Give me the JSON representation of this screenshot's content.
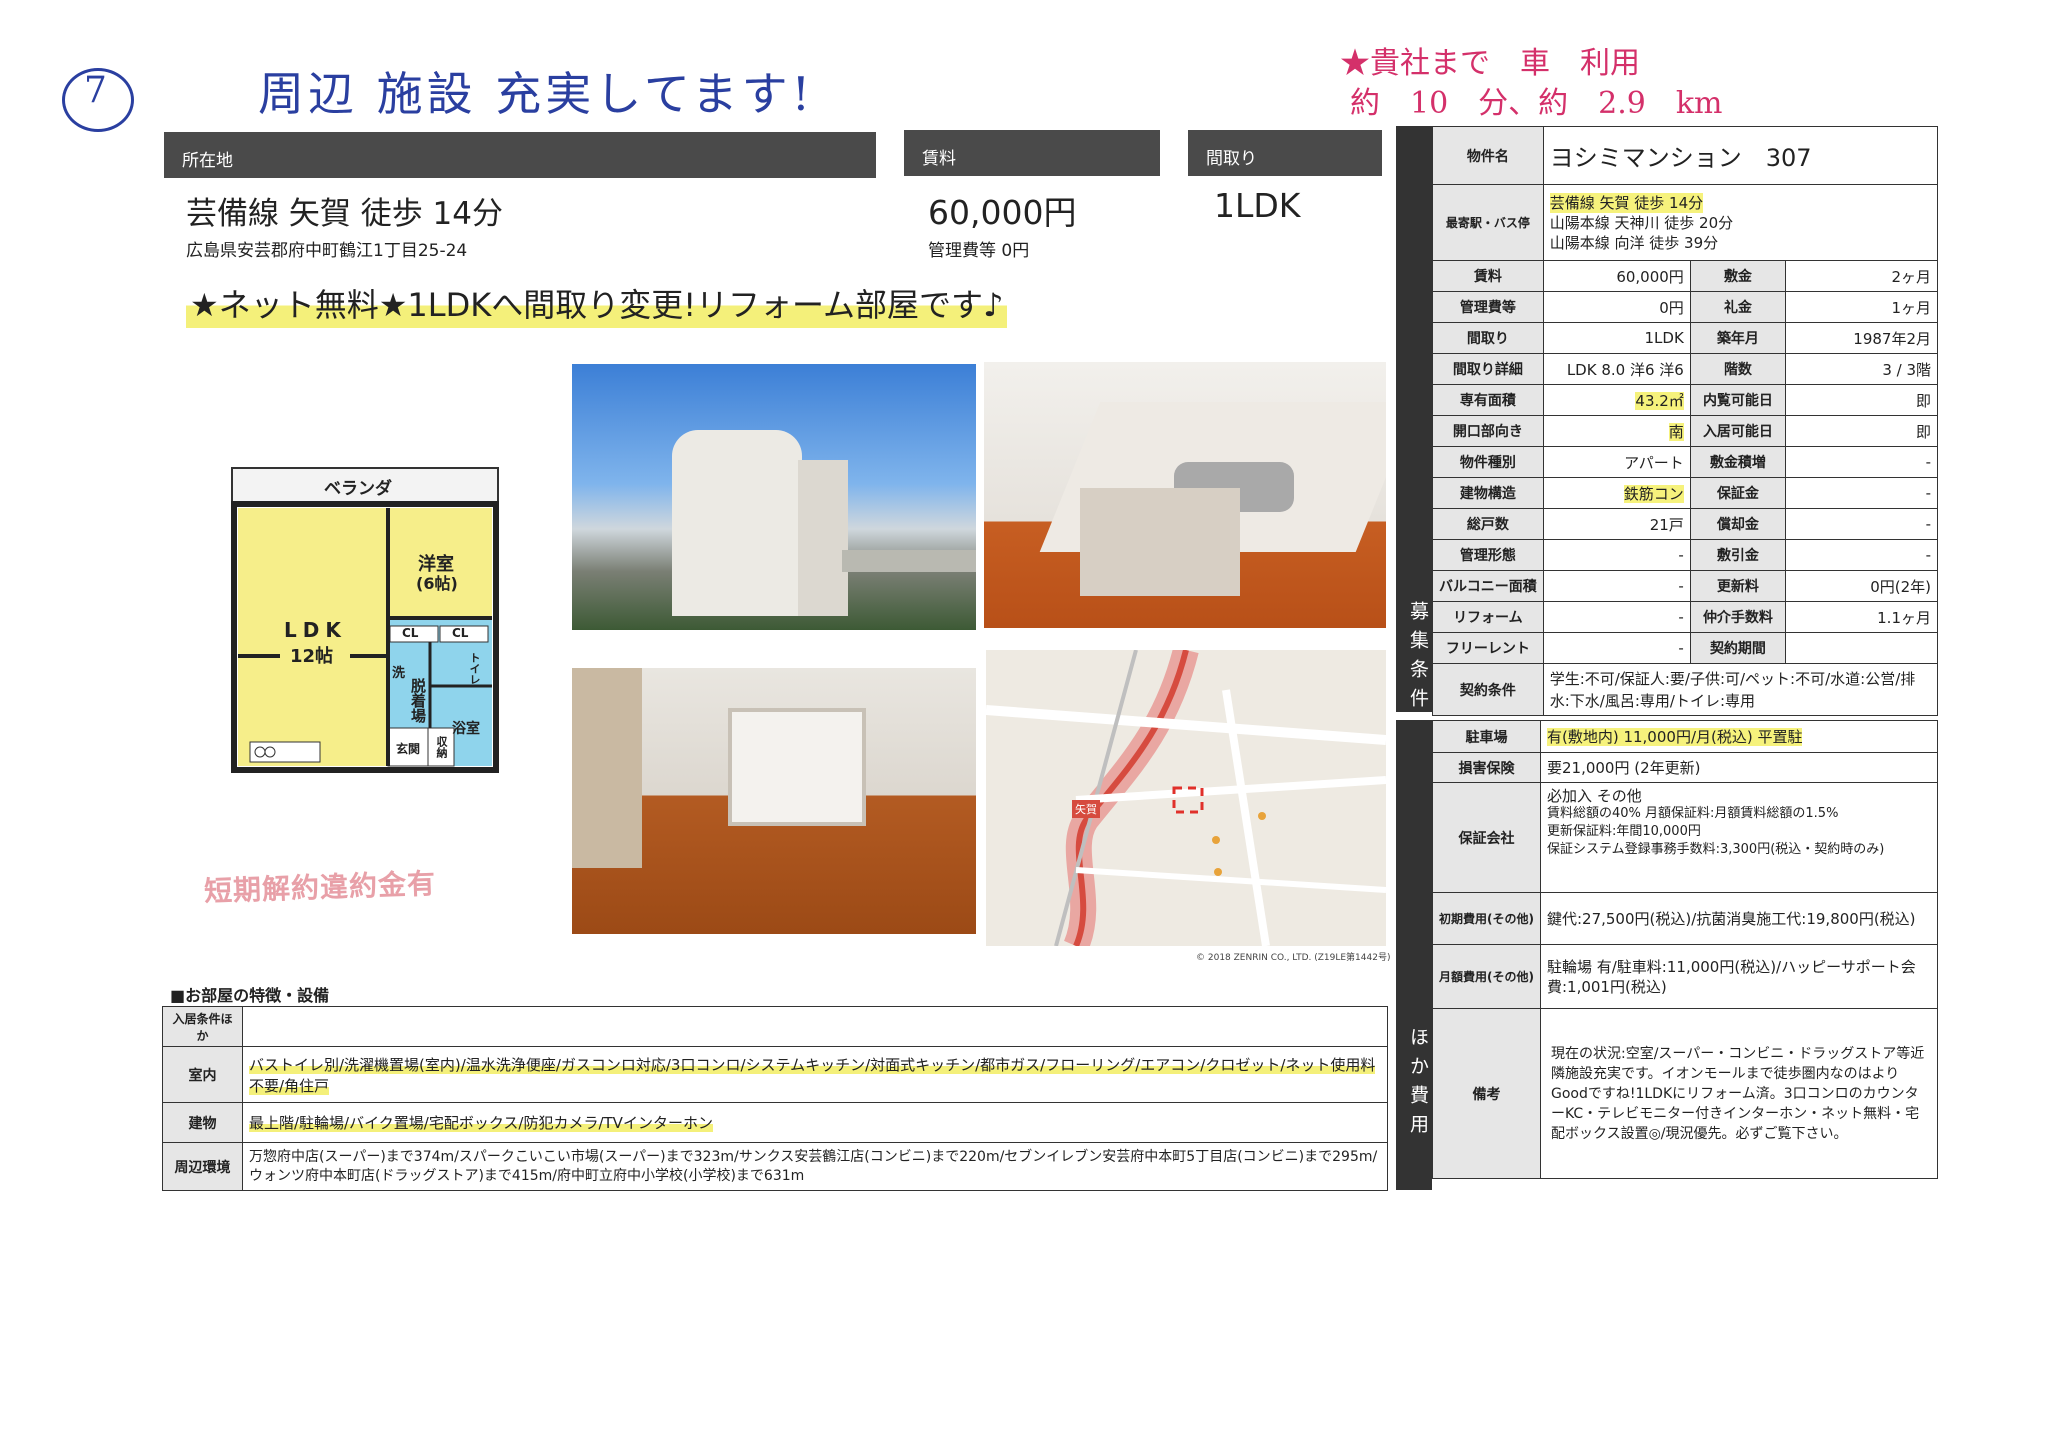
{
  "handwriting": {
    "circle_number": "7",
    "note_top": "周辺 施設 充実してます!",
    "note_right_1": "★貴社まで　車　利用",
    "note_right_2": "約　10　分、約　2.9　km",
    "stamp": "短期解約違約金有"
  },
  "header": {
    "location_label": "所在地",
    "rent_label": "賃料",
    "layout_label": "間取り"
  },
  "summary": {
    "station": "芸備線 矢賀 徒歩 14分",
    "address": "広島県安芸郡府中町鶴江1丁目25-24",
    "rent": "60,000円",
    "mgmt_fee": "管理費等 0円",
    "layout": "1LDK",
    "catchcopy": "★ネット無料★1LDKへ間取り変更!リフォーム部屋です♪"
  },
  "floorplan": {
    "veranda": "ベランダ",
    "western_room": "洋室",
    "western_size": "(6帖)",
    "ldk": "LDK",
    "ldk_size": "12帖",
    "cl1": "CL",
    "cl2": "CL",
    "wash": "洗",
    "toilet": "トイレ",
    "dressing": "脱着場",
    "bath": "浴室",
    "entrance": "玄関",
    "storage": "収納"
  },
  "map": {
    "copyright": "© 2018 ZENRIN CO., LTD. (Z19LE第1442号)",
    "station_label": "矢賀"
  },
  "spec": {
    "band_recruit": "募集条件",
    "band_other": "ほか費用",
    "name_label": "物件名",
    "name": "ヨシミマンション　307",
    "station_label": "最寄駅・バス停",
    "stations": [
      "芸備線 矢賀 徒歩 14分",
      "山陽本線 天神川 徒歩 20分",
      "山陽本線 向洋 徒歩 39分"
    ],
    "rows": [
      {
        "l1": "賃料",
        "v1": "60,000円",
        "l2": "敷金",
        "v2": "2ヶ月"
      },
      {
        "l1": "管理費等",
        "v1": "0円",
        "l2": "礼金",
        "v2": "1ヶ月"
      },
      {
        "l1": "間取り",
        "v1": "1LDK",
        "l2": "築年月",
        "v2": "1987年2月"
      },
      {
        "l1": "間取り詳細",
        "v1": "LDK 8.0 洋6 洋6",
        "l2": "階数",
        "v2": "3 / 3階"
      },
      {
        "l1": "専有面積",
        "v1": "43.2㎡",
        "l2": "内覧可能日",
        "v2": "即"
      },
      {
        "l1": "開口部向き",
        "v1": "南",
        "l2": "入居可能日",
        "v2": "即"
      },
      {
        "l1": "物件種別",
        "v1": "アパート",
        "l2": "敷金積増",
        "v2": "-"
      },
      {
        "l1": "建物構造",
        "v1": "鉄筋コン",
        "l2": "保証金",
        "v2": "-"
      },
      {
        "l1": "総戸数",
        "v1": "21戸",
        "l2": "償却金",
        "v2": "-"
      },
      {
        "l1": "管理形態",
        "v1": "-",
        "l2": "敷引金",
        "v2": "-"
      },
      {
        "l1": "バルコニー面積",
        "v1": "-",
        "l2": "更新料",
        "v2": "0円(2年)"
      },
      {
        "l1": "リフォーム",
        "v1": "-",
        "l2": "仲介手数料",
        "v2": "1.1ヶ月"
      },
      {
        "l1": "フリーレント",
        "v1": "-",
        "l2": "契約期間",
        "v2": ""
      }
    ],
    "contract_label": "契約条件",
    "contract": "学生:不可/保証人:要/子供:可/ペット:不可/水道:公営/排水:下水/風呂:専用/トイレ:専用",
    "parking_label": "駐車場",
    "parking": "有(敷地内) 11,000円/月(税込) 平置駐",
    "insurance_label": "損害保険",
    "insurance": "要21,000円 (2年更新)",
    "guarantee_label": "保証会社",
    "guarantee_lines": [
      "必加入 その他",
      "賃料総額の40% 月額保証料:月額賃料総額の1.5%",
      "更新保証料:年間10,000円",
      "保証システム登録事務手数料:3,300円(税込・契約時のみ)"
    ],
    "initial_label": "初期費用(その他)",
    "initial": "鍵代:27,500円(税込)/抗菌消臭施工代:19,800円(税込)",
    "monthly_label": "月額費用(その他)",
    "monthly": "駐輪場 有/駐車料:11,000円(税込)/ハッピーサポート会費:1,001円(税込)",
    "remarks_label": "備考",
    "remarks": "現在の状況:空室/スーパー・コンビニ・ドラッグストア等近隣施設充実です。イオンモールまで徒歩圏内なのはよりGoodですね!1LDKにリフォーム済。3口コンロのカウンターKC・テレビモニター付きインターホン・ネット無料・宅配ボックス設置◎/現況優先。必ずご覧下さい。"
  },
  "features": {
    "heading": "■お部屋の特徴・設備",
    "rows": [
      {
        "label": "入居条件ほか",
        "text": ""
      },
      {
        "label": "室内",
        "text": "バストイレ別/洗濯機置場(室内)/温水洗浄便座/ガスコンロ対応/3口コンロ/システムキッチン/対面式キッチン/都市ガス/フローリング/エアコン/クロゼット/ネット使用料不要/角住戸"
      },
      {
        "label": "建物",
        "text": "最上階/駐輪場/バイク置場/宅配ボックス/防犯カメラ/TVインターホン"
      },
      {
        "label": "周辺環境",
        "text": "万惣府中店(スーパー)まで374m/スパークこいこい市場(スーパー)まで323m/サンクス安芸鶴江店(コンビニ)まで220m/セブンイレブン安芸府中本町5丁目店(コンビニ)まで295m/ウォンツ府中本町店(ドラッグストア)まで415m/府中町立府中小学校(小学校)まで631m"
      }
    ]
  }
}
